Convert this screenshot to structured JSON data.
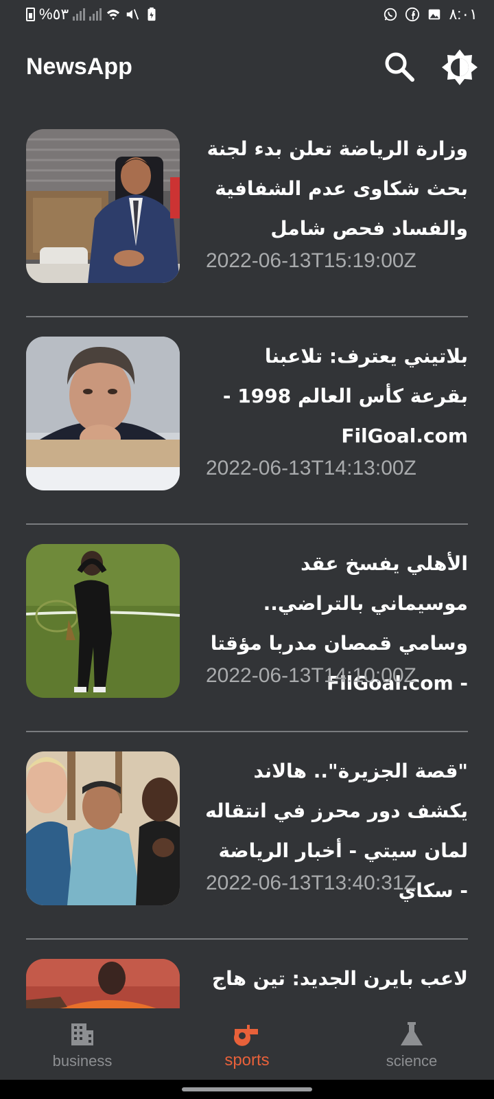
{
  "status_bar": {
    "battery_text": "%٥٣",
    "time": "٨:٠١"
  },
  "app_bar": {
    "title": "NewsApp"
  },
  "articles": [
    {
      "title": "وزارة الرياضة تعلن بدء لجنة بحث شكاوى عدم الشفافية والفساد فحص شامل",
      "published_at": "2022-06-13T15:19:00Z"
    },
    {
      "title": "بلاتيني يعترف: تلاعبنا بقرعة كأس العالم 1998 - FilGoal.com",
      "published_at": "2022-06-13T14:13:00Z"
    },
    {
      "title": "الأهلي يفسخ عقد موسيماني بالتراضي.. وسامي قمصان مدربا مؤقتا - FilGoal.com",
      "published_at": "2022-06-13T14:10:00Z"
    },
    {
      "title": "\"قصة الجزيرة\".. هالاند يكشف دور محرز في انتقاله لمان سيتي - أخبار الرياضة - سكاي",
      "published_at": "2022-06-13T13:40:31Z"
    },
    {
      "title": "لاعب بايرن الجديد: تين هاج",
      "published_at": ""
    }
  ],
  "bottom_nav": {
    "items": [
      {
        "label": "business",
        "icon": "building-icon",
        "active": false
      },
      {
        "label": "sports",
        "icon": "whistle-icon",
        "active": true
      },
      {
        "label": "science",
        "icon": "flask-icon",
        "active": false
      }
    ]
  },
  "colors": {
    "background": "#323437",
    "accent": "#e8613a",
    "muted_text": "#a9abad",
    "divider": "#7a7c7f"
  }
}
